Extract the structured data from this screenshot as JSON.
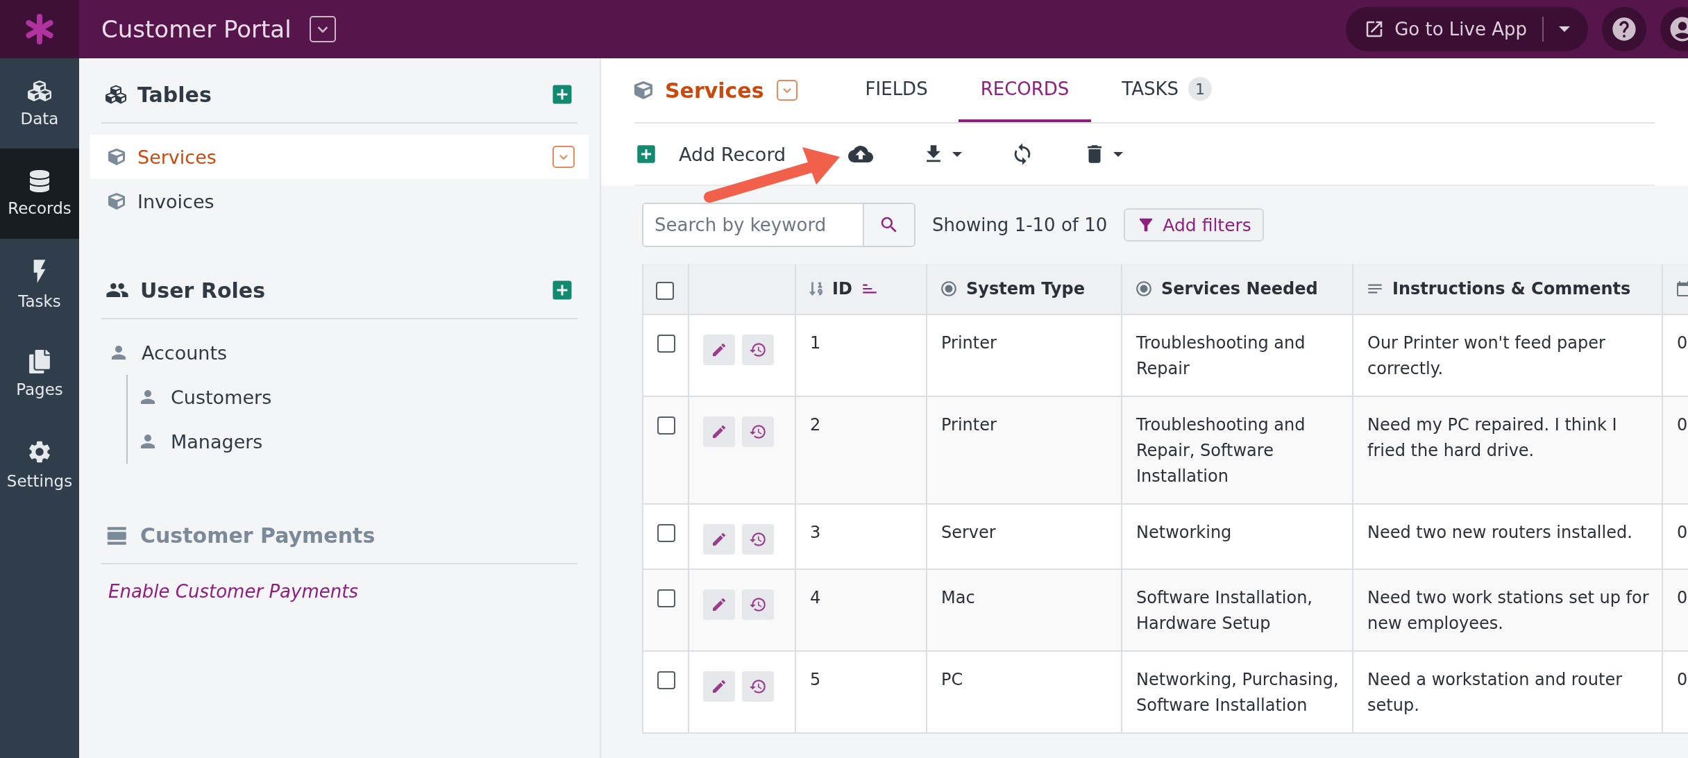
{
  "app": {
    "title": "Customer Portal",
    "live_app_button": "Go to Live App"
  },
  "nav": [
    {
      "label": "Data",
      "kind": "data",
      "selected": false
    },
    {
      "label": "Records",
      "kind": "records",
      "selected": true
    },
    {
      "label": "Tasks",
      "kind": "tasks",
      "selected": false
    },
    {
      "label": "Pages",
      "kind": "pages",
      "selected": false
    },
    {
      "label": "Settings",
      "kind": "settings",
      "selected": false
    }
  ],
  "sidebar": {
    "tables": {
      "title": "Tables",
      "items": [
        {
          "label": "Services",
          "selected": true
        },
        {
          "label": "Invoices",
          "selected": false
        }
      ]
    },
    "user_roles": {
      "title": "User Roles",
      "items": [
        {
          "label": "Accounts",
          "children": [
            {
              "label": "Customers"
            },
            {
              "label": "Managers"
            }
          ]
        }
      ]
    },
    "payments": {
      "title": "Customer Payments",
      "link": "Enable Customer Payments"
    }
  },
  "header": {
    "table_name": "Services"
  },
  "tabs": [
    {
      "label": "FIELDS",
      "selected": false
    },
    {
      "label": "RECORDS",
      "selected": true
    },
    {
      "label": "TASKS",
      "badge": "1",
      "selected": false
    }
  ],
  "toolbar": {
    "add_record": "Add Record"
  },
  "search": {
    "placeholder": "Search by keyword"
  },
  "showing": "Showing 1-10 of 10",
  "filters_button": "Add filters",
  "table": {
    "select_all": {
      "checked": false
    },
    "columns": [
      {
        "label": "ID",
        "kind": "id"
      },
      {
        "label": "System Type",
        "kind": "choice"
      },
      {
        "label": "Services Needed",
        "kind": "choice"
      },
      {
        "label": "Instructions & Comments",
        "kind": "text"
      },
      {
        "kind": "date"
      }
    ],
    "rows": [
      {
        "checked": false,
        "cells": [
          "1",
          "Printer",
          "Troubleshooting and Repair",
          "Our Printer won't feed paper correctly.",
          "0"
        ]
      },
      {
        "checked": false,
        "cells": [
          "2",
          "Printer",
          "Troubleshooting and Repair, Software Installation",
          "Need my PC repaired. I think I fried the hard drive.",
          "0"
        ]
      },
      {
        "checked": false,
        "cells": [
          "3",
          "Server",
          "Networking",
          "Need two new routers installed.",
          "0"
        ]
      },
      {
        "checked": false,
        "cells": [
          "4",
          "Mac",
          "Software Installation, Hardware Setup",
          "Need two work stations set up for new employees.",
          "0"
        ]
      },
      {
        "checked": false,
        "cells": [
          "5",
          "PC",
          "Networking, Purchasing, Software Installation",
          "Need a workstation and router setup.",
          "0"
        ]
      }
    ]
  }
}
